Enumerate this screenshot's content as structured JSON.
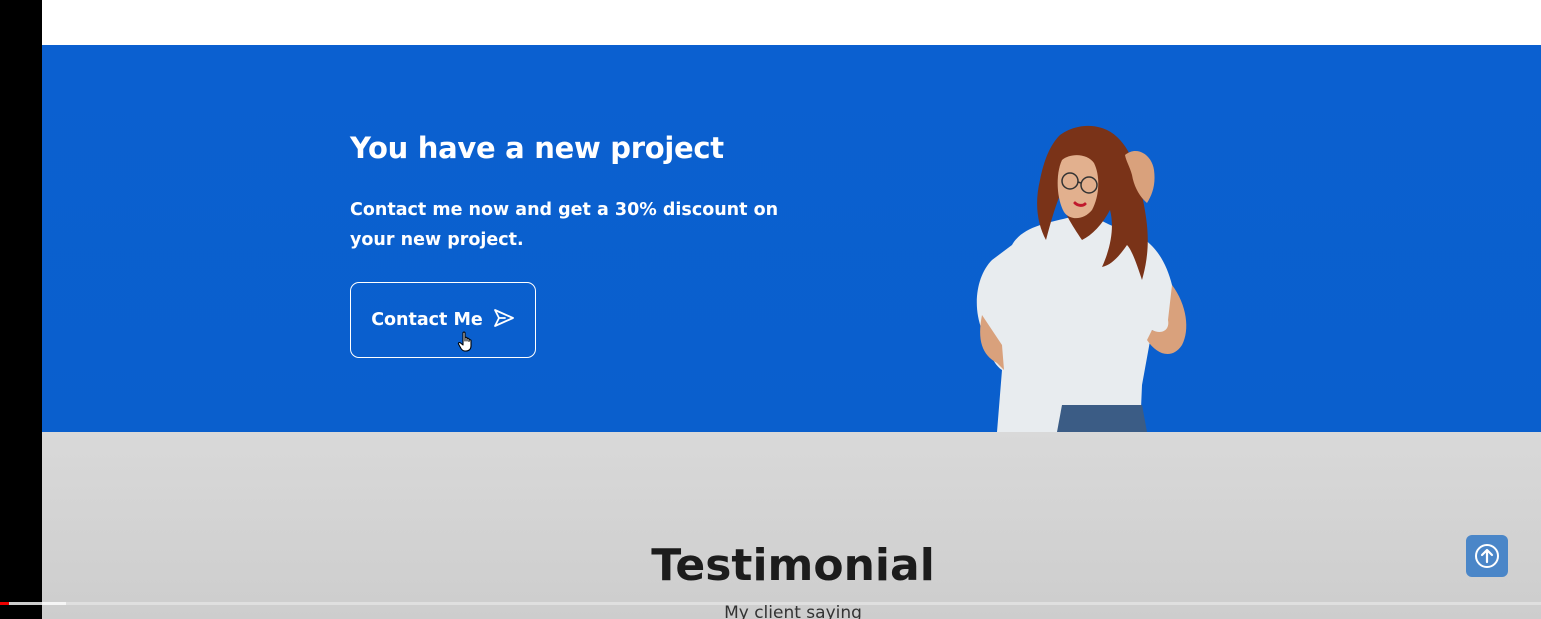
{
  "cta": {
    "title": "You have a new project",
    "description": "Contact me now and get a 30% discount on your new project.",
    "button_label": "Contact Me",
    "background_color": "#0a5fcd"
  },
  "testimonial": {
    "title": "Testimonial",
    "subtitle": "My client saying"
  },
  "scroll_top": {
    "icon": "arrow-up-icon"
  },
  "video_progress": {
    "played_fraction": 0.006,
    "buffered_fraction": 0.043
  }
}
